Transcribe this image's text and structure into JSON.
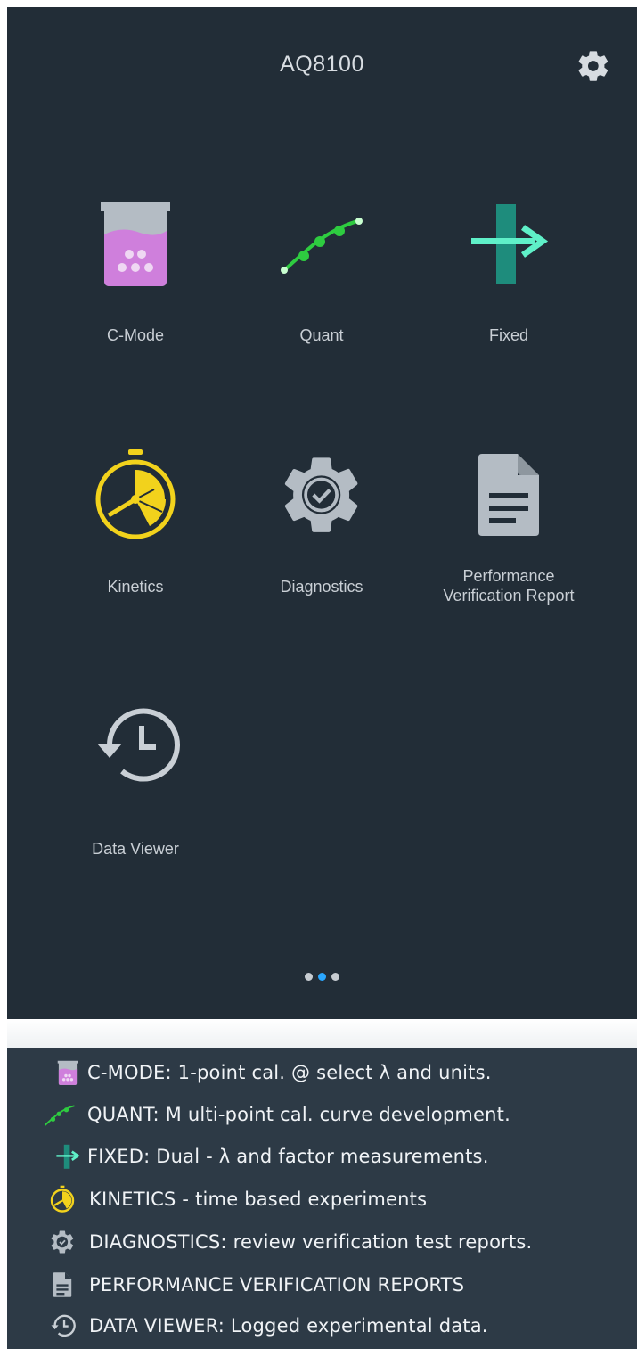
{
  "header": {
    "title": "AQ8100",
    "settings_icon": "gear-icon"
  },
  "apps": [
    {
      "label": "C-Mode",
      "icon": "beaker-icon"
    },
    {
      "label": "Quant",
      "icon": "calibration-curve-icon"
    },
    {
      "label": "Fixed",
      "icon": "fixed-wavelength-icon"
    },
    {
      "label": "Kinetics",
      "icon": "stopwatch-icon"
    },
    {
      "label": "Diagnostics",
      "icon": "gear-check-icon"
    },
    {
      "label": "Performance\nVerification Report",
      "icon": "document-icon"
    },
    {
      "label": "Data Viewer",
      "icon": "history-clock-icon"
    }
  ],
  "pager": {
    "pages": 3,
    "active_index": 1
  },
  "legend": [
    {
      "text": "C-MODE: 1-point cal. @ select λ and units.",
      "icon": "beaker-icon"
    },
    {
      "text": "QUANT: M ulti-point cal. curve development.",
      "icon": "calibration-curve-icon"
    },
    {
      "text": "FIXED: Dual - λ  and factor measurements.",
      "icon": "fixed-wavelength-icon"
    },
    {
      "text": "KINETICS - time based experiments",
      "icon": "stopwatch-icon"
    },
    {
      "text": "DIAGNOSTICS: review verification test reports.",
      "icon": "gear-check-icon"
    },
    {
      "text": "PERFORMANCE VERIFICATION REPORTS",
      "icon": "document-icon"
    },
    {
      "text": "DATA VIEWER: Logged experimental data.",
      "icon": "history-clock-icon"
    }
  ],
  "colors": {
    "screen_bg": "#222d37",
    "legend_bg": "#2d3a46",
    "kinetics_yellow": "#f2d21c",
    "quant_green": "#2ecc40",
    "fixed_teal": "#1e8c7c",
    "fixed_arrow": "#5ff0c8",
    "cmode_purple": "#cf7fdc",
    "icon_grey": "#b4bcc4",
    "pager_active": "#2aa7ff"
  }
}
